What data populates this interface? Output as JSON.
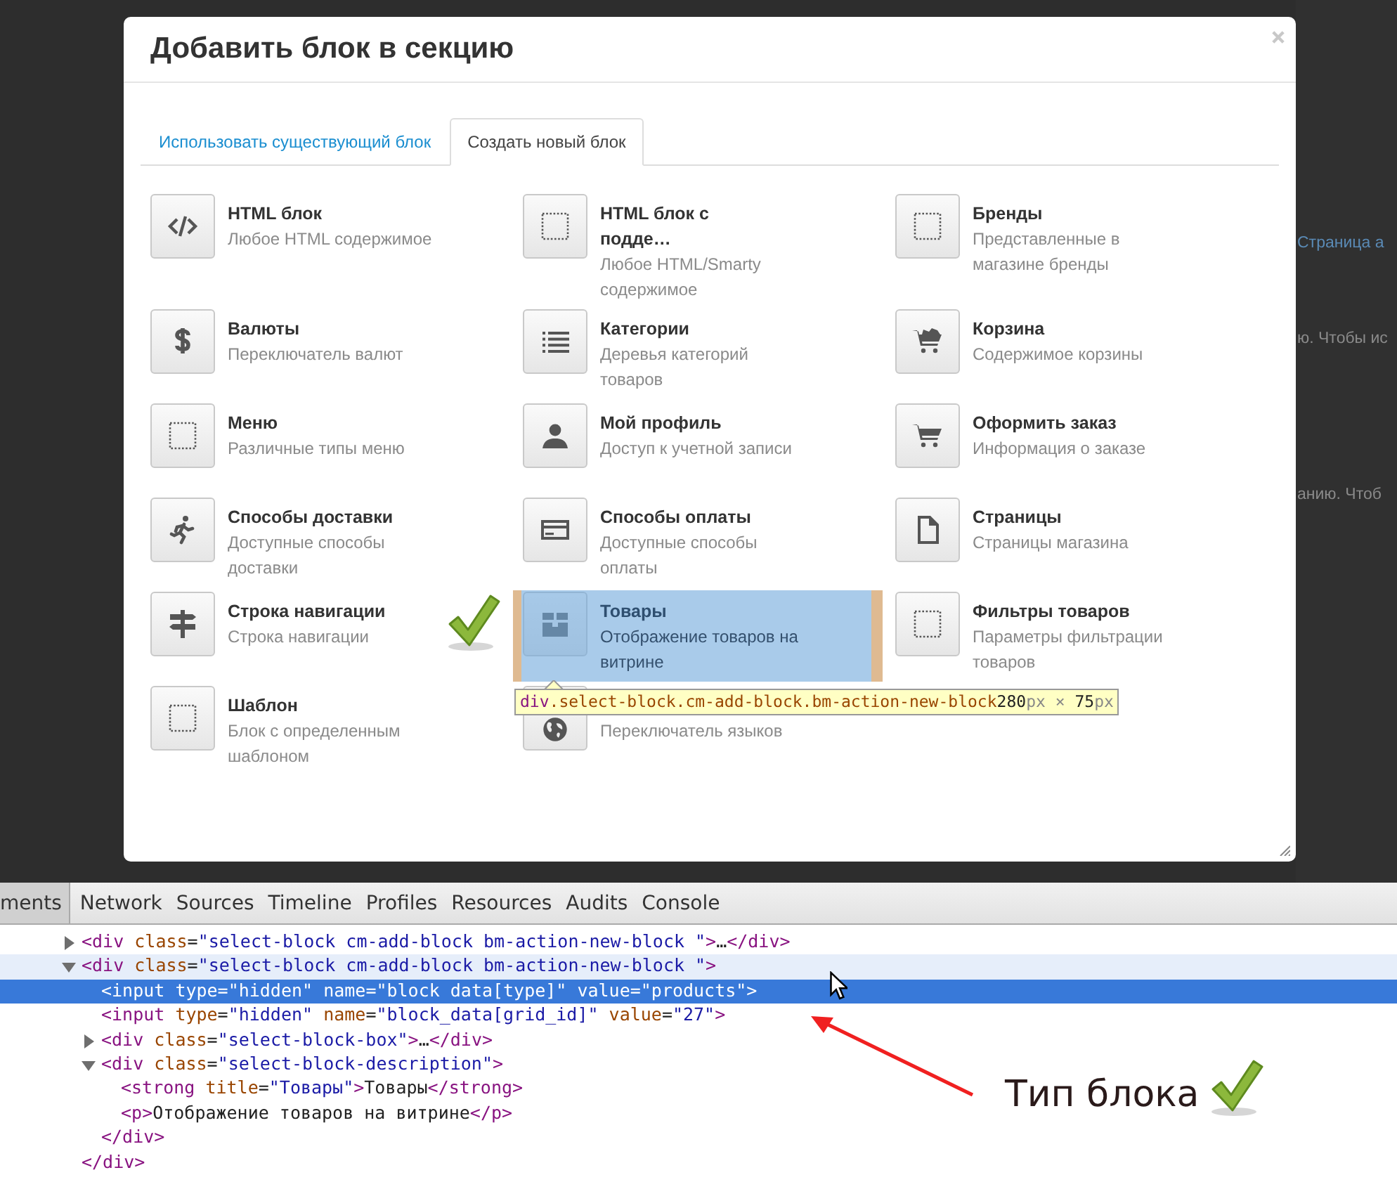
{
  "background_page": {
    "fragments": [
      {
        "text": "Страница а",
        "kind": "link"
      },
      {
        "text": "ю. Чтобы ис",
        "kind": "text"
      },
      {
        "text": "анию. Чтоб",
        "kind": "text"
      }
    ]
  },
  "dialog": {
    "title": "Добавить блок в секцию",
    "tabs": [
      {
        "label": "Использовать существующий блок",
        "selected": false
      },
      {
        "label": "Создать новый блок",
        "selected": true
      }
    ],
    "blocks": [
      {
        "title": "HTML блок",
        "description": "Любое HTML содержимое",
        "kind": "code",
        "highlighted": false
      },
      {
        "title": "HTML блок с\nподде…",
        "description": "Любое HTML/Smarty содержимое",
        "kind": "placeholder",
        "highlighted": false
      },
      {
        "title": "Бренды",
        "description": "Представленные в магазине бренды",
        "kind": "placeholder",
        "highlighted": false
      },
      {
        "title": "Валюты",
        "description": "Переключатель валют",
        "kind": "dollar",
        "highlighted": false
      },
      {
        "title": "Категории",
        "description": "Деревья категорий товаров",
        "kind": "list",
        "highlighted": false
      },
      {
        "title": "Корзина",
        "description": "Содержимое корзины",
        "kind": "cartfull",
        "highlighted": false
      },
      {
        "title": "Меню",
        "description": "Различные типы меню",
        "kind": "placeholder",
        "highlighted": false
      },
      {
        "title": "Мой профиль",
        "description": "Доступ к учетной записи",
        "kind": "user",
        "highlighted": false
      },
      {
        "title": "Оформить заказ",
        "description": "Информация о заказе",
        "kind": "cart",
        "highlighted": false
      },
      {
        "title": "Способы доставки",
        "description": "Доступные способы доставки",
        "kind": "runner",
        "highlighted": false
      },
      {
        "title": "Способы оплаты",
        "description": "Доступные способы оплаты",
        "kind": "card",
        "highlighted": false
      },
      {
        "title": "Страницы",
        "description": "Страницы магазина",
        "kind": "document",
        "highlighted": false
      },
      {
        "title": "Строка навигации",
        "description": "Строка навигации",
        "kind": "signpost",
        "highlighted": false
      },
      {
        "title": "Товары",
        "description": "Отображение товаров на витрине",
        "kind": "box",
        "highlighted": true
      },
      {
        "title": "Фильтры товаров",
        "description": "Параметры фильтрации товаров",
        "kind": "placeholder",
        "highlighted": false
      },
      {
        "title": "Шаблон",
        "description": "Блок с определенным шаблоном",
        "kind": "placeholder",
        "highlighted": false
      },
      {
        "description": "Переключатель языков",
        "kind": "globe",
        "highlighted": false
      }
    ],
    "inspector_tooltip": {
      "selector": "div.select-block.cm-add-block.bm-action-new-block",
      "size": "280px × 75px"
    }
  },
  "devtools": {
    "tabs": [
      {
        "label": "ments",
        "selected": true
      },
      {
        "label": "Network",
        "selected": false
      },
      {
        "label": "Sources",
        "selected": false
      },
      {
        "label": "Timeline",
        "selected": false
      },
      {
        "label": "Profiles",
        "selected": false
      },
      {
        "label": "Resources",
        "selected": false
      },
      {
        "label": "Audits",
        "selected": false
      },
      {
        "label": "Console",
        "selected": false
      }
    ],
    "tree": [
      {
        "text": "<div class=\"select-block cm-add-block bm-action-new-block \">…</div>",
        "expanded": false,
        "selected": false,
        "hovered": false
      },
      {
        "text": "<div class=\"select-block cm-add-block bm-action-new-block \">",
        "expanded": true,
        "selected": false,
        "hovered": true,
        "closing": "</div>",
        "children": [
          {
            "text": "<input type=\"hidden\" name=\"block data[type]\" value=\"products\">",
            "selected": true,
            "hovered": false
          },
          {
            "text": "<input type=\"hidden\" name=\"block_data[grid_id]\" value=\"27\">",
            "selected": false,
            "hovered": false
          },
          {
            "text": "<div class=\"select-block-box\">…</div>",
            "expanded": false,
            "selected": false,
            "hovered": false
          },
          {
            "text": "<div class=\"select-block-description\">",
            "expanded": true,
            "selected": false,
            "hovered": false,
            "closing": "</div>",
            "children": [
              {
                "text": "<strong title=\"Товары\">Товары</strong>",
                "selected": false,
                "hovered": false
              },
              {
                "text": "<p>Отображение товаров на витрине</p>",
                "selected": false,
                "hovered": false
              }
            ]
          }
        ]
      }
    ]
  },
  "annotation": {
    "label": "Тип блока"
  }
}
